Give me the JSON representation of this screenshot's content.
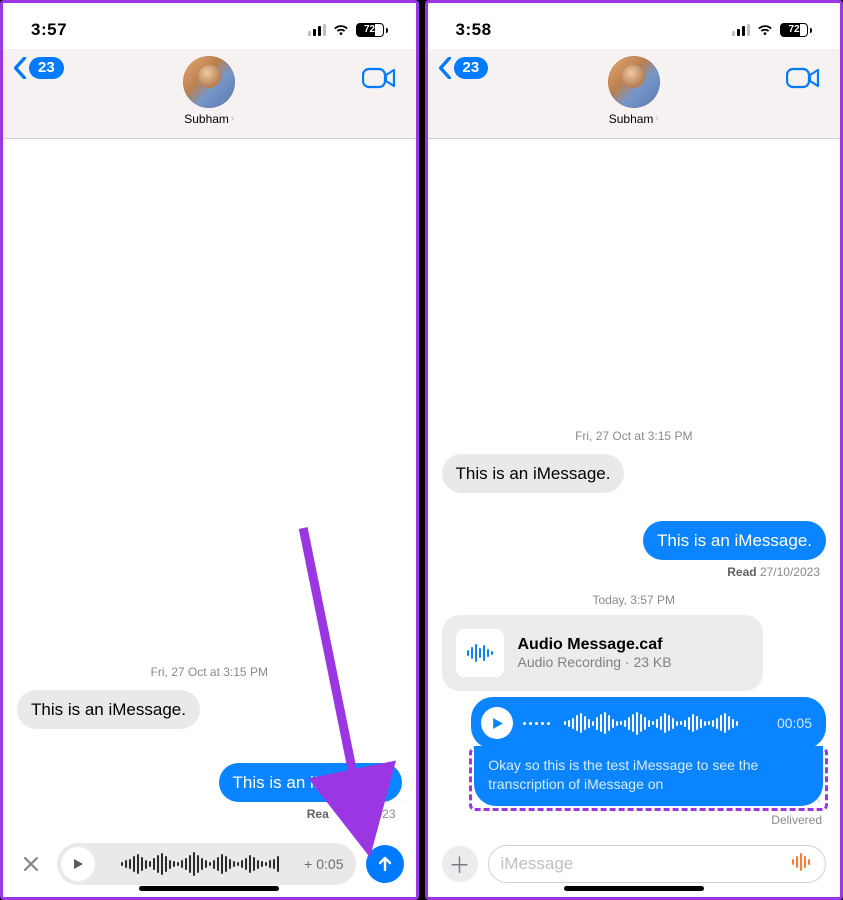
{
  "left": {
    "status": {
      "time": "3:57",
      "battery": "72"
    },
    "header": {
      "back_count": "23",
      "contact_name": "Subham"
    },
    "timestamp_main": "Fri, 27 Oct at 3:15 PM",
    "msg_in": "This is an iMessage.",
    "msg_out": "This is an iMessage.",
    "read_line_label": "Rea",
    "read_line_date": "0/2023",
    "composer": {
      "duration": "+ 0:05"
    }
  },
  "right": {
    "status": {
      "time": "3:58",
      "battery": "72"
    },
    "header": {
      "back_count": "23",
      "contact_name": "Subham"
    },
    "timestamp_1": "Fri, 27 Oct at 3:15 PM",
    "msg_in": "This is an iMessage.",
    "msg_out": "This is an iMessage.",
    "read_label": "Read",
    "read_date": "27/10/2023",
    "timestamp_2": "Today, 3:57 PM",
    "attachment": {
      "title": "Audio Message.caf",
      "subtitle": "Audio Recording · 23 KB"
    },
    "voice": {
      "time": "00:05",
      "transcript": "Okay so this is the test iMessage to see the transcription of iMessage on"
    },
    "delivered": "Delivered",
    "composer": {
      "placeholder": "iMessage"
    }
  }
}
